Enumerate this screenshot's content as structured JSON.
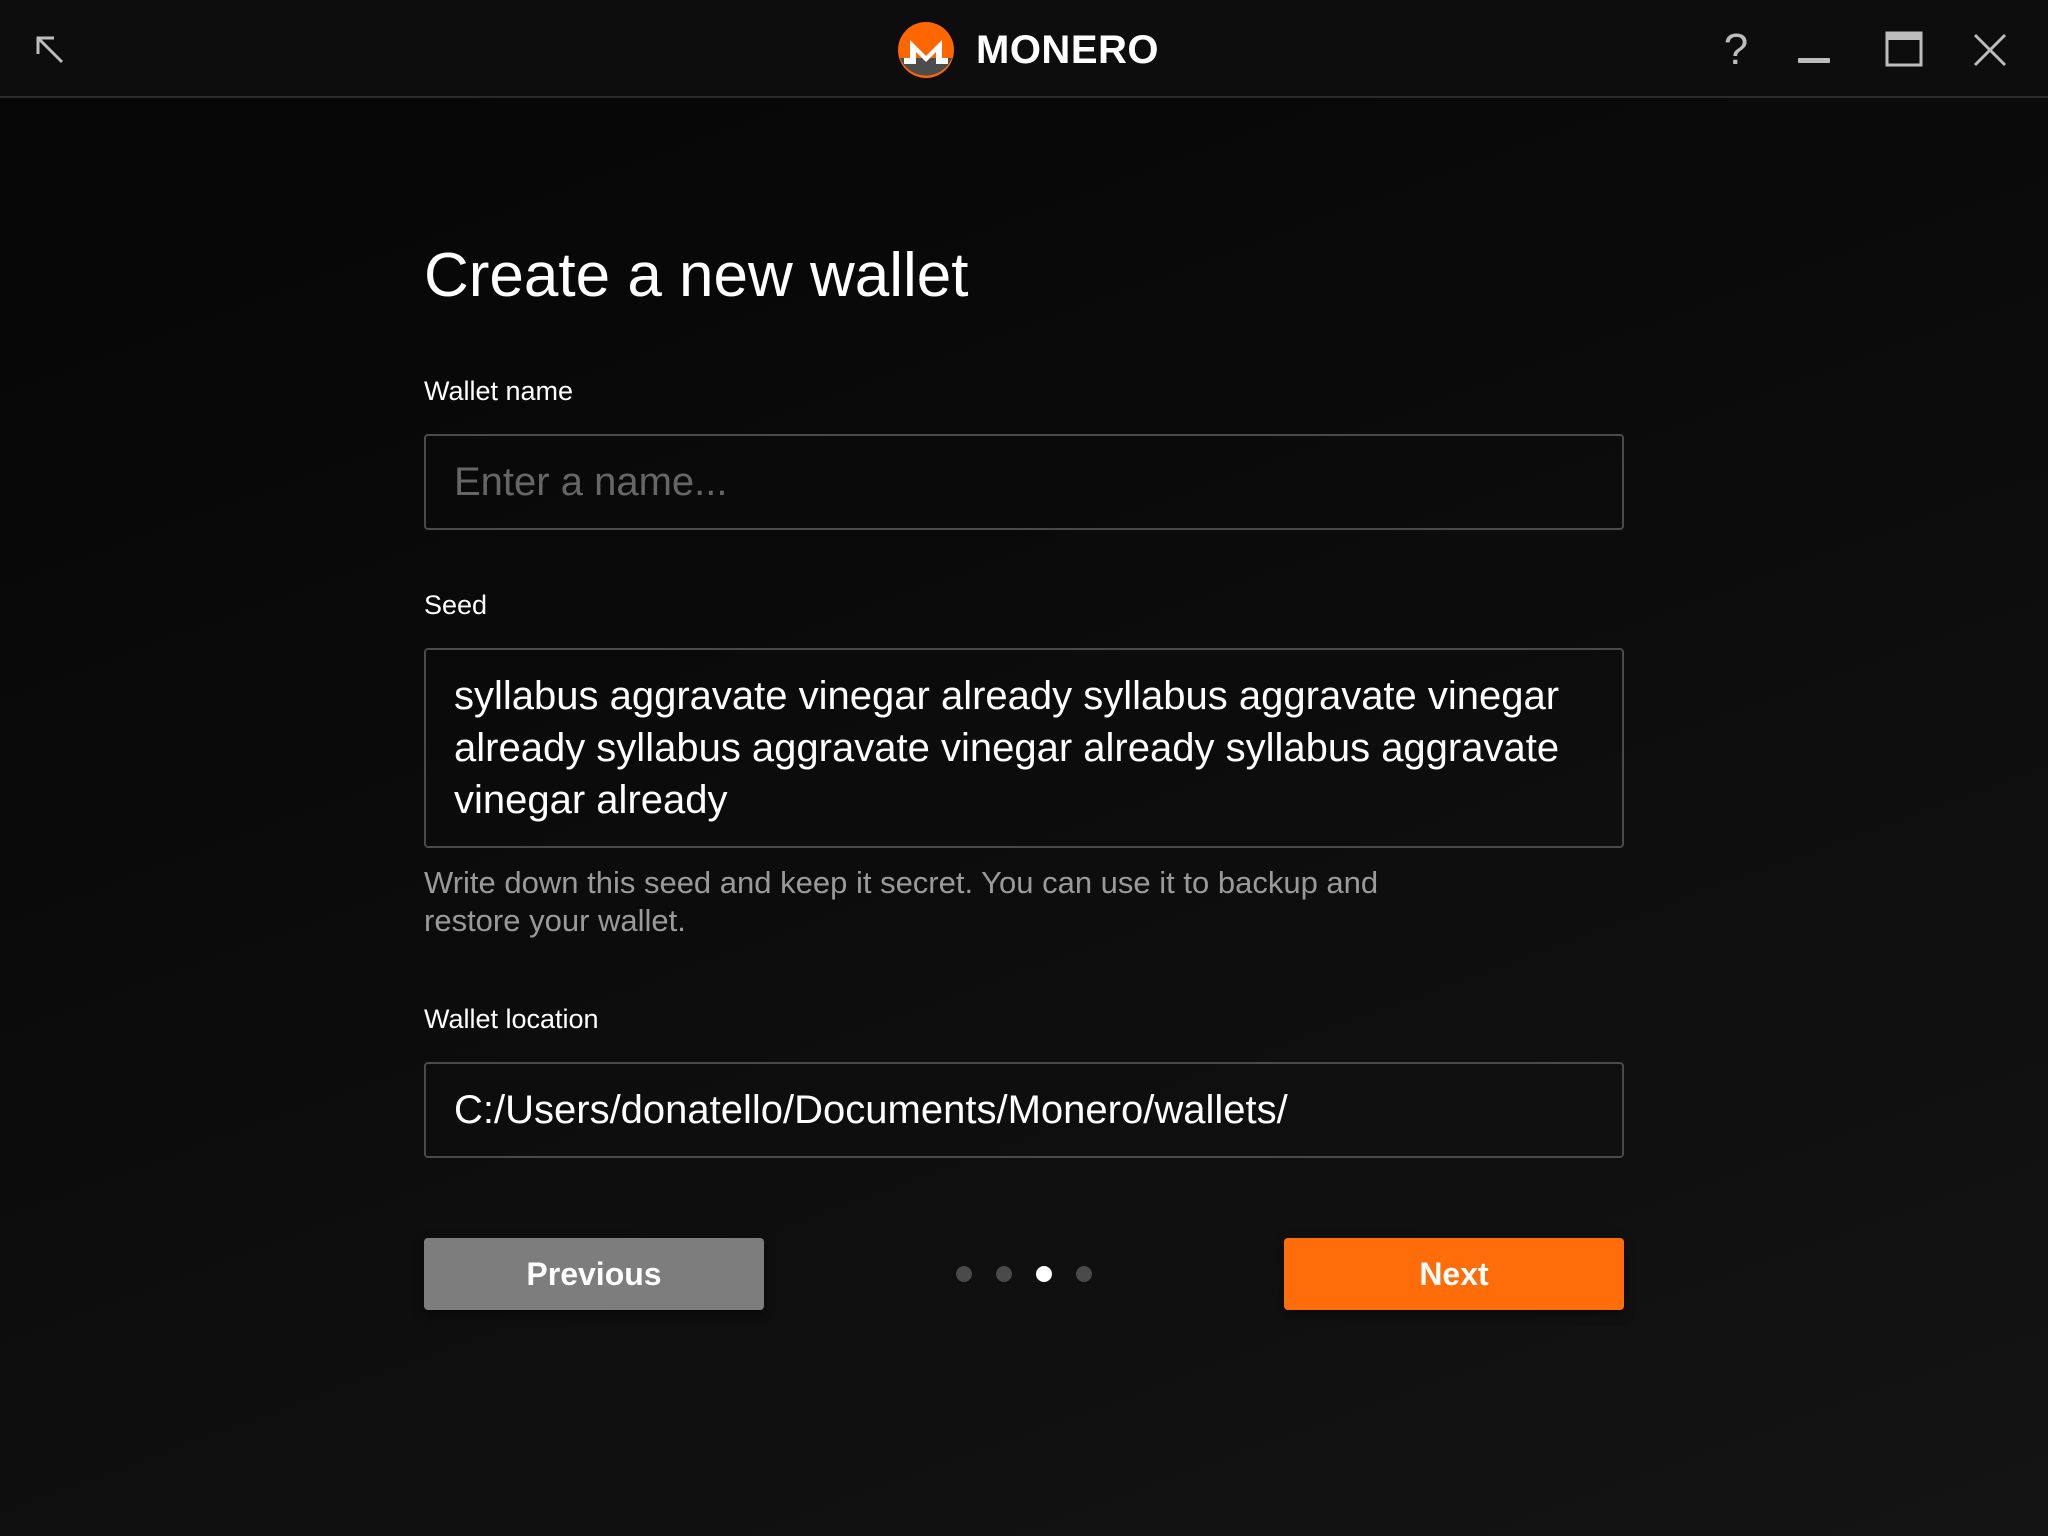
{
  "titlebar": {
    "app_name": "MONERO",
    "icons": {
      "back": "arrow-up-left-icon",
      "help": "question-mark-icon",
      "minimize": "minimize-icon",
      "maximize": "maximize-icon",
      "close": "close-icon"
    },
    "help_glyph": "?"
  },
  "main": {
    "title": "Create a new wallet",
    "wallet_name": {
      "label": "Wallet name",
      "value": "",
      "placeholder": "Enter a name..."
    },
    "seed": {
      "label": "Seed",
      "value": "syllabus aggravate vinegar already syllabus aggravate vinegar already syllabus aggravate vinegar already syllabus aggravate vinegar already",
      "hint": "Write down this seed and keep it secret. You can use it to backup and restore your wallet."
    },
    "wallet_location": {
      "label": "Wallet location",
      "value": "C:/Users/donatello/Documents/Monero/wallets/"
    }
  },
  "navigation": {
    "previous_label": "Previous",
    "next_label": "Next",
    "steps_total": 4,
    "current_step": 3
  },
  "colors": {
    "accent": "#ff6c0a",
    "secondary_button": "#7d7d7d",
    "background": "#0b0b0b"
  }
}
